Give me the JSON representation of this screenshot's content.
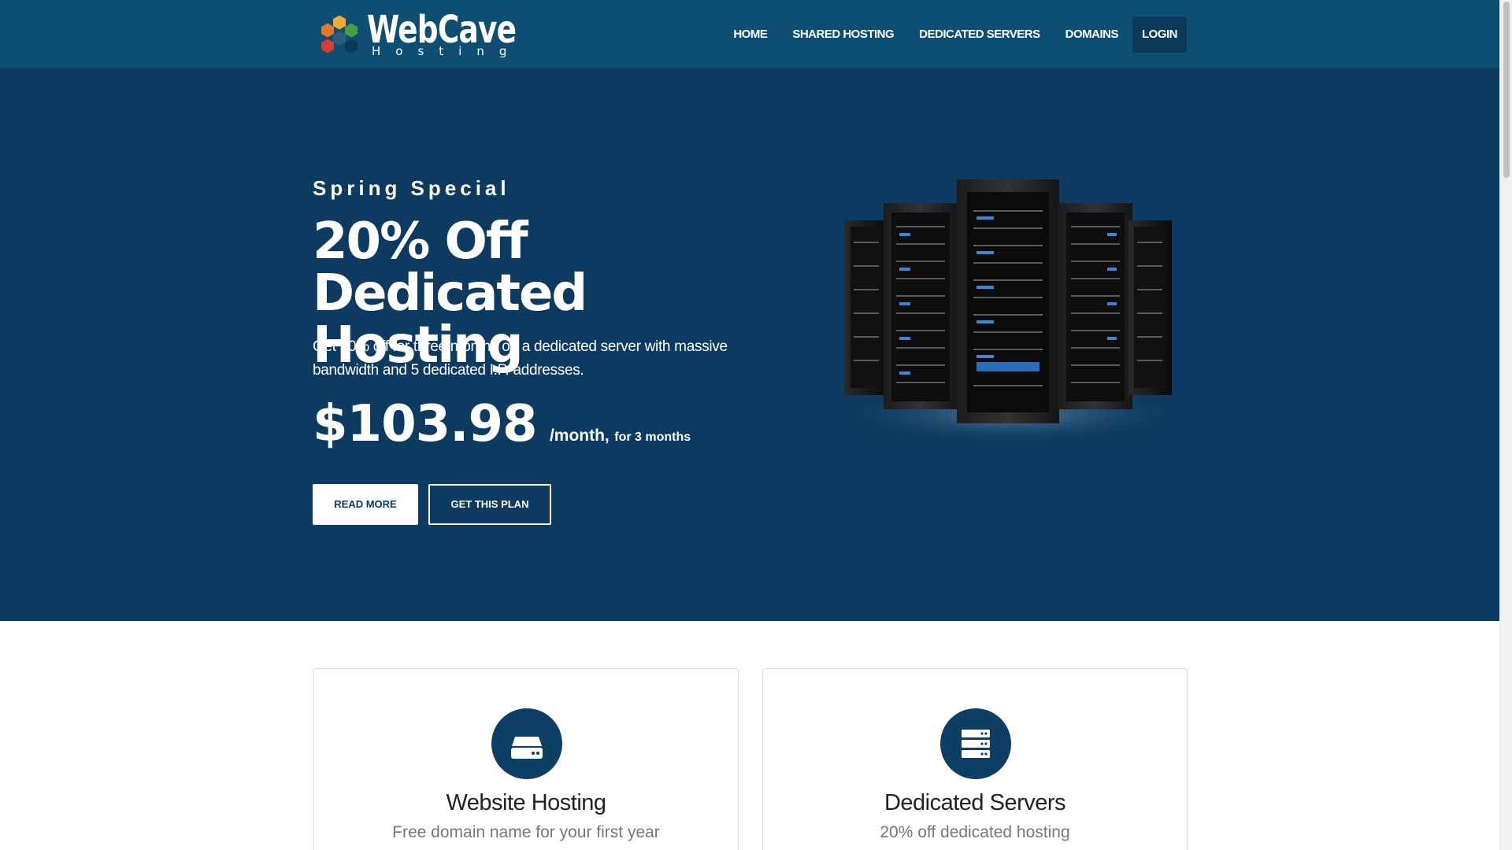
{
  "brand": {
    "name": "WebCave",
    "subtitle": "Hosting",
    "logo_colors": [
      "#e8762c",
      "#f2a93b",
      "#4a9b45",
      "#d93c34",
      "#0d4e72"
    ]
  },
  "nav": {
    "items": [
      {
        "label": "HOME"
      },
      {
        "label": "SHARED HOSTING"
      },
      {
        "label": "DEDICATED SERVERS"
      },
      {
        "label": "DOMAINS"
      },
      {
        "label": "LOGIN"
      }
    ]
  },
  "hero": {
    "eyebrow": "Spring Special",
    "title": "20% Off Dedicated Hosting",
    "description": "Get 20% off for three months on a dedicated server with massive bandwidth and 5 dedicated I.P. addresses.",
    "price": "$103.98",
    "price_unit": "/month,",
    "price_note": "for 3 months",
    "buttons": {
      "read_more": "READ MORE",
      "get_plan": "GET THIS PLAN"
    },
    "image_icon": "server-racks-image"
  },
  "cards": [
    {
      "icon": "hard-drive-icon",
      "title": "Website Hosting",
      "subtitle": "Free domain name for your first year"
    },
    {
      "icon": "server-stack-icon",
      "title": "Dedicated Servers",
      "subtitle": "20% off dedicated hosting"
    }
  ],
  "colors": {
    "header_bg": "#0d4e72",
    "hero_bg": "#0c3a60",
    "accent": "#0d3e64"
  }
}
